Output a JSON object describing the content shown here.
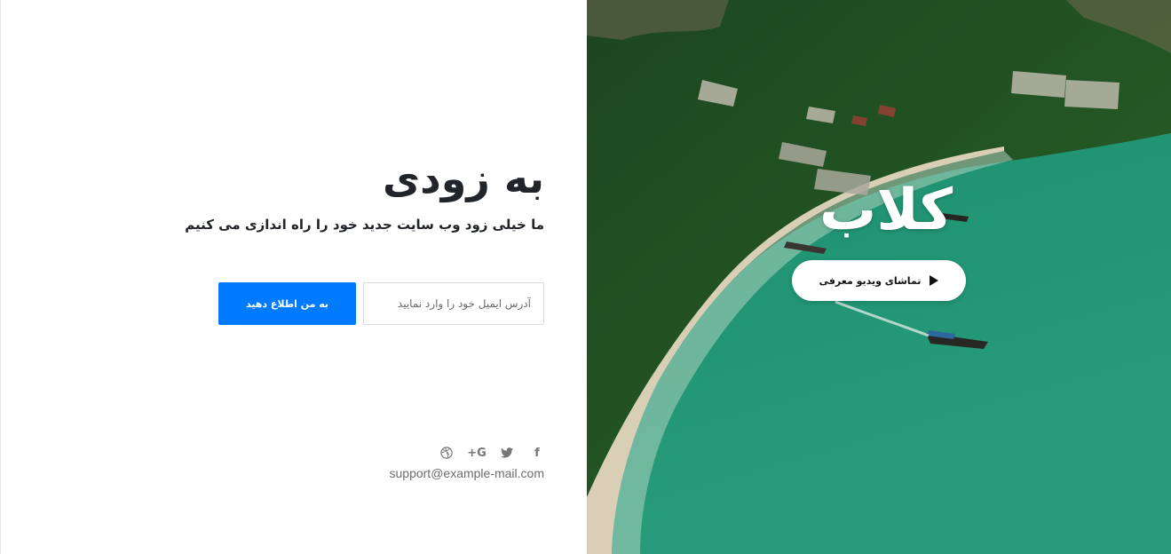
{
  "hero": {
    "title": "به زودی",
    "subtitle": "ما خیلی زود وب سایت جدید خود را راه اندازی می کنیم"
  },
  "subscribe": {
    "email_placeholder": "آدرس ایمیل خود را وارد نمایید",
    "notify_label": "به من اطلاع دهید"
  },
  "social": {
    "icons": [
      "facebook-icon",
      "twitter-icon",
      "google-plus-icon",
      "dribbble-icon"
    ],
    "facebook_glyph": "f",
    "google_glyph": "G+"
  },
  "contact": {
    "email": "support@example-mail.com"
  },
  "brand": {
    "logo_text": "کلاب"
  },
  "video": {
    "label": "تماشای ویدیو معرفی"
  },
  "colors": {
    "accent": "#007bff",
    "sea": "#1aa07a",
    "text": "#212529"
  }
}
